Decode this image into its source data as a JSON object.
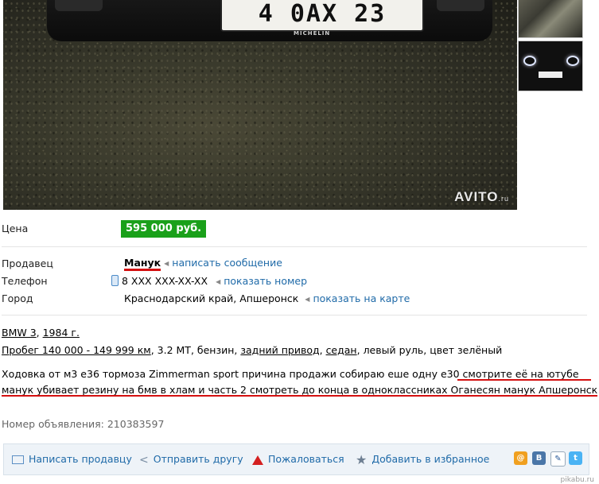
{
  "photo": {
    "plate_text": "4 0АХ 23",
    "bumper_label": "MICHELIN",
    "bumper_label_right": "",
    "watermark": "AVITO",
    "watermark_suffix": ".ru"
  },
  "thumbnails": [
    "thumbnail-engine",
    "thumbnail-car-front"
  ],
  "price": {
    "label": "Цена",
    "value": "595 000 руб."
  },
  "seller": {
    "label": "Продавец",
    "name": "Манук",
    "action": "написать сообщение"
  },
  "phone": {
    "label": "Телефон",
    "value": "8 XXX XXX-XX-XX",
    "action": "показать номер"
  },
  "city": {
    "label": "Город",
    "value": "Краснодарский край, Апшеронск",
    "action": "показать на карте"
  },
  "car": {
    "model": "BMW 3",
    "year": "1984 г.",
    "mileage": "Пробег 140 000 - 149 999 км",
    "engine": "3.2 MT",
    "fuel": "бензин",
    "drive": "задний привод",
    "body": "седан",
    "wheel": "левый руль",
    "color": "цвет зелёный"
  },
  "description": {
    "line1_start": "Ходовка от м3 е36 тормоза Zimmerman sport причина продажи собираю еше одну е30 ",
    "line1_underlined": "смотрите её на ютубе",
    "line2": "манук убивает резину на бмв в хлам и часть 2 смотреть до конца в одноклассниках Оганесян манук Апшеронск"
  },
  "ad_number": "Номер объявления: 210383597",
  "actions": {
    "write": "Написать продавцу",
    "send": "Отправить другу",
    "report": "Пожаловаться",
    "favorite": "Добавить в избранное"
  },
  "social": [
    "odnoklassniki",
    "vkontakte",
    "livejournal",
    "twitter"
  ],
  "corner_watermark": "pikabu.ru",
  "colors": {
    "price_bg": "#1aa01a",
    "link": "#1f6aa8",
    "underline_red": "#d41010"
  }
}
